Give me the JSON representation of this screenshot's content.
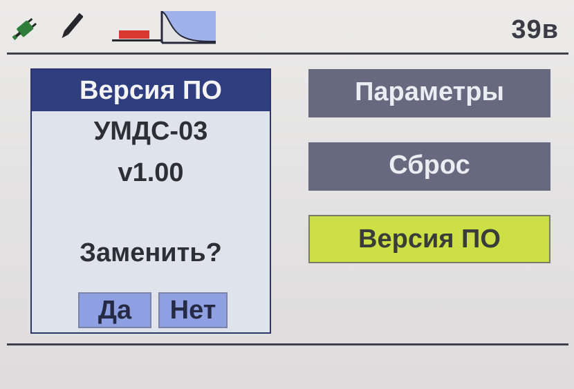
{
  "status_bar": {
    "icons": [
      "plug-icon",
      "pencil-icon",
      "battery-icon",
      "decay-curve-icon"
    ],
    "voltage": "39в"
  },
  "dialog": {
    "title": "Версия ПО",
    "device_name": "УМДС-03",
    "version": "v1.00",
    "question": "Заменить?",
    "yes_label": "Да",
    "no_label": "Нет"
  },
  "menu": {
    "items": [
      {
        "label": "Параметры",
        "selected": false
      },
      {
        "label": "Сброс",
        "selected": false
      },
      {
        "label": "Версия ПО",
        "selected": true
      }
    ]
  },
  "colors": {
    "title_bar": "#2f3e7e",
    "menu_item": "#676a7e",
    "menu_selected": "#ccdf45",
    "dialog_button": "#8ea0e2",
    "battery_fill": "#d8382d",
    "plug": "#2e7d3a"
  }
}
